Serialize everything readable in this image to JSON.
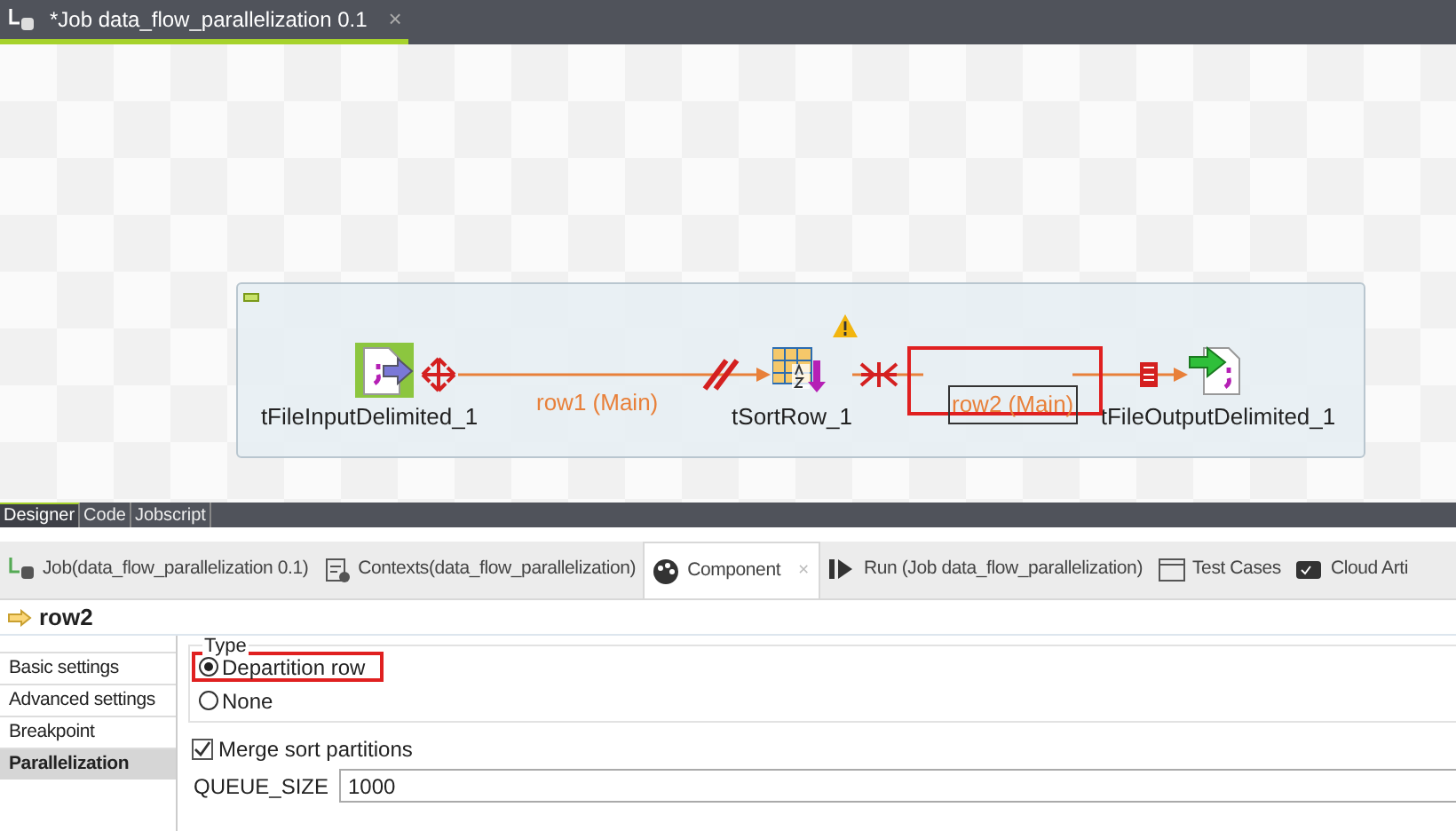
{
  "editor_tab": {
    "title": "*Job data_flow_parallelization 0.1",
    "close": "×"
  },
  "canvas": {
    "nodes": [
      {
        "label": "tFileInputDelimited_1",
        "kind": "input",
        "warning": false
      },
      {
        "label": "tSortRow_1",
        "kind": "sort",
        "warning": true
      },
      {
        "label": "tFileOutputDelimited_1",
        "kind": "output",
        "warning": false
      }
    ],
    "links": [
      {
        "label": "row1 (Main)",
        "highlighted": false
      },
      {
        "label": "row2 (Main)",
        "highlighted": true
      }
    ]
  },
  "view_tabs": [
    {
      "label": "Designer",
      "selected": true
    },
    {
      "label": "Code",
      "selected": false
    },
    {
      "label": "Jobscript",
      "selected": false
    }
  ],
  "panel_tabs": [
    {
      "label": "Job(data_flow_parallelization 0.1)",
      "kind": "job",
      "selected": false
    },
    {
      "label": "Contexts(data_flow_parallelization)",
      "kind": "contexts",
      "selected": false
    },
    {
      "label": "Component",
      "kind": "component",
      "selected": true,
      "close": "×"
    },
    {
      "label": "Run (Job data_flow_parallelization)",
      "kind": "run",
      "selected": false
    },
    {
      "label": "Test Cases",
      "kind": "tests",
      "selected": false
    },
    {
      "label": "Cloud Arti",
      "kind": "cloud",
      "selected": false
    }
  ],
  "component_title": "row2",
  "settings_menu": [
    {
      "label": "Basic settings",
      "selected": false
    },
    {
      "label": "Advanced settings",
      "selected": false
    },
    {
      "label": "Breakpoint",
      "selected": false
    },
    {
      "label": "Parallelization",
      "selected": true
    }
  ],
  "type_group": {
    "title": "Type",
    "options": [
      {
        "label": "Departition row",
        "selected": true,
        "highlighted": true
      },
      {
        "label": "None",
        "selected": false,
        "highlighted": false
      }
    ]
  },
  "merge_sort": {
    "label": "Merge sort partitions",
    "checked": true
  },
  "queue_size": {
    "label": "QUEUE_SIZE",
    "value": "1000"
  }
}
